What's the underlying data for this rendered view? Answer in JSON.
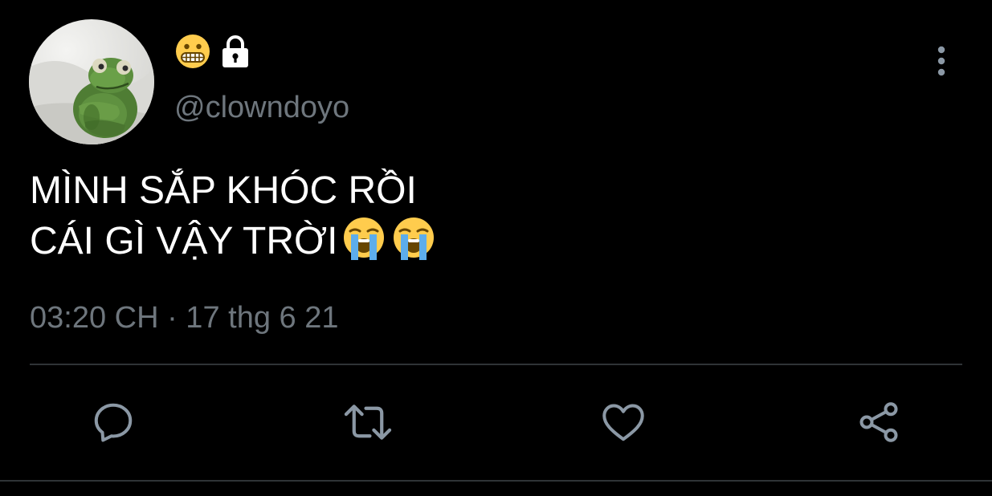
{
  "tweet": {
    "display_name_emoji": "grimacing-face-emoji",
    "protected_icon": "lock-icon",
    "handle": "@clowndoyo",
    "text": "MÌNH SẮP KHÓC RỒI\nCÁI GÌ VẬY TRỜI",
    "text_trailing_emojis": [
      "loudly-crying-face-emoji",
      "loudly-crying-face-emoji"
    ],
    "timestamp": "03:20 CH · 17 thg 6 21",
    "avatar": "avatar-green-plush-frog"
  },
  "actions": [
    {
      "name": "reply",
      "icon": "reply-icon"
    },
    {
      "name": "retweet",
      "icon": "retweet-icon"
    },
    {
      "name": "like",
      "icon": "heart-icon"
    },
    {
      "name": "share",
      "icon": "share-icon"
    }
  ],
  "menu": {
    "icon": "more-vertical-icon"
  },
  "colors": {
    "background": "#000000",
    "text_primary": "#ffffff",
    "text_secondary": "#6e767d",
    "divider": "#2f3336",
    "icon": "#8b98a5"
  }
}
